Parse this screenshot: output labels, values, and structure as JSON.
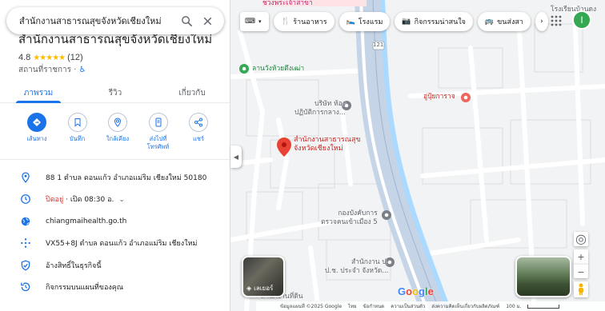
{
  "search": {
    "value": "สำนักงานสาธารณสุขจังหวัดเชียงใหม่",
    "search_icon": "search-icon",
    "close_icon": "close-icon"
  },
  "place": {
    "title": "สำนักงานสาธารณสุขจังหวัดเชียงใหม่",
    "rating": "4.8",
    "stars": "★★★★★",
    "review_count": "(12)",
    "category": "สถานที่ราชการ ·",
    "accessibility_icon": "wheelchair-icon"
  },
  "tabs": [
    {
      "label": "ภาพรวม",
      "active": true
    },
    {
      "label": "รีวิว",
      "active": false
    },
    {
      "label": "เกี่ยวกับ",
      "active": false
    }
  ],
  "actions": [
    {
      "label": "เส้นทาง",
      "icon": "directions-icon"
    },
    {
      "label": "บันทึก",
      "icon": "bookmark-icon"
    },
    {
      "label": "ใกล้เคียง",
      "icon": "nearby-icon"
    },
    {
      "label": "ส่งไปที่โทรศัพท์",
      "icon": "send-to-phone-icon"
    },
    {
      "label": "แชร์",
      "icon": "share-icon"
    }
  ],
  "info": {
    "address": "88 1 ตำบล ดอนแก้ว อำเภอแม่ริม เชียงใหม่ 50180",
    "hours_status": "ปิดอยู่",
    "hours_next": " · เปิด 08:30 อ.",
    "website": "chiangmaihealth.go.th",
    "plus_code": "VX55+8J ตำบล ดอนแก้ว อำเภอแม่ริม เชียงใหม่",
    "claim": "อ้างสิทธิ์ในธุรกิจนี้",
    "history": "กิจกรรมบนแผนที่ของคุณ"
  },
  "chips": [
    {
      "label": "ร้านอาหาร",
      "icon": "restaurant-icon"
    },
    {
      "label": "โรงแรม",
      "icon": "hotel-icon"
    },
    {
      "label": "กิจกรรมน่าสนใจ",
      "icon": "camera-icon"
    },
    {
      "label": "ขนส่งสา",
      "icon": "transit-icon"
    }
  ],
  "map": {
    "pin_label": "สำนักงานสาธารณสุข\nจังหวัดเชียงใหม่",
    "labels": {
      "top_pink": "ชวงพระเจ้าสาขา",
      "school": "โรงเรียนบ้านดง",
      "park": "ลานวังห้วยตึงเฒ่า",
      "company": "บริษัท ห้อง\nปฏิบัติการกลาง...",
      "garage": "อู่ปุ้ยการาจ",
      "check_office": "กองบังคับการ\nตรวจคนเข้าเมือง 5",
      "social_office": "สำนักงาน ป.\nป.ช. ประจำ จังหวัด...",
      "land_office": "สำนักงานที่ดิน",
      "route_number": "121"
    },
    "layers_label": "เลเยอร์",
    "avatar_initial": "I",
    "avatar_color": "#34a853"
  },
  "attribution": {
    "copyright": "ข้อมูลแผนที่ ©2025 Google",
    "links": [
      "ไทย",
      "ข้อกำหนด",
      "ความเป็นส่วนตัว",
      "ส่งความคิดเห็นเกี่ยวกับผลิตภัณฑ์"
    ],
    "scale": "100 ม."
  },
  "google_logo": "Google"
}
